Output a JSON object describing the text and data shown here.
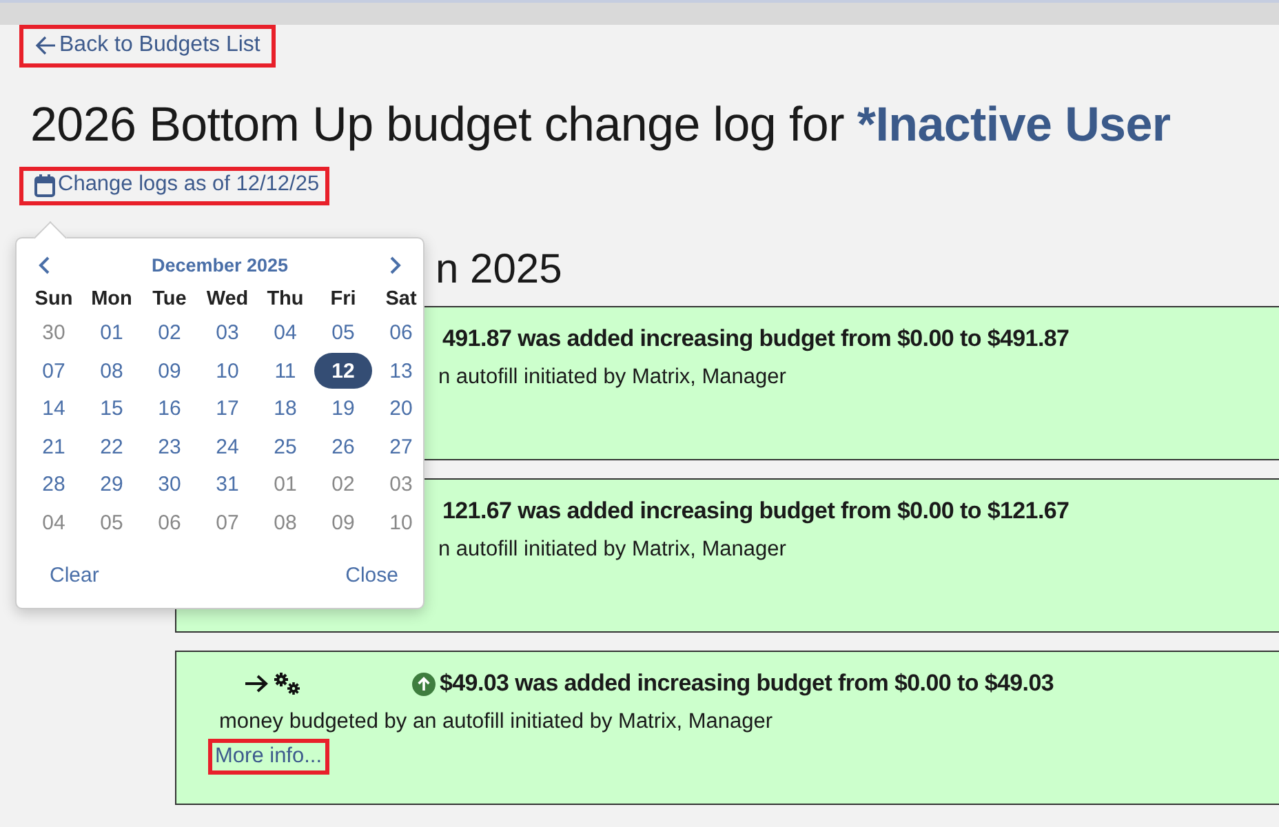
{
  "back_link": {
    "label": "Back to Budgets List",
    "highlighted": true
  },
  "title": {
    "prefix": "2026 Bottom Up budget change log for ",
    "user": "*Inactive User"
  },
  "date_link": {
    "label": "Change logs as of 12/12/25",
    "highlighted": true
  },
  "section_heading": "n 2025",
  "entries": [
    {
      "kind": "partial",
      "summary": "491.87 was added increasing budget from $0.00 to $491.87",
      "detail": "n autofill initiated by Matrix, Manager"
    },
    {
      "kind": "partial",
      "summary": "121.67 was added increasing budget from $0.00 to $121.67",
      "detail": "n autofill initiated by Matrix, Manager"
    },
    {
      "kind": "full",
      "summary": "$49.03 was added increasing budget from $0.00 to $49.03",
      "detail": "money budgeted by an autofill initiated by Matrix, Manager",
      "more": {
        "label": "More info...",
        "highlighted": true
      }
    }
  ],
  "calendar": {
    "month": "December 2025",
    "weekdays": [
      "Sun",
      "Mon",
      "Tue",
      "Wed",
      "Thu",
      "Fri",
      "Sat"
    ],
    "weeks": [
      [
        {
          "label": "30",
          "outside": true,
          "selected": false
        },
        {
          "label": "01",
          "outside": false,
          "selected": false
        },
        {
          "label": "02",
          "outside": false,
          "selected": false
        },
        {
          "label": "03",
          "outside": false,
          "selected": false
        },
        {
          "label": "04",
          "outside": false,
          "selected": false
        },
        {
          "label": "05",
          "outside": false,
          "selected": false
        },
        {
          "label": "06",
          "outside": false,
          "selected": false
        }
      ],
      [
        {
          "label": "07",
          "outside": false,
          "selected": false
        },
        {
          "label": "08",
          "outside": false,
          "selected": false
        },
        {
          "label": "09",
          "outside": false,
          "selected": false
        },
        {
          "label": "10",
          "outside": false,
          "selected": false
        },
        {
          "label": "11",
          "outside": false,
          "selected": false
        },
        {
          "label": "12",
          "outside": false,
          "selected": true
        },
        {
          "label": "13",
          "outside": false,
          "selected": false
        }
      ],
      [
        {
          "label": "14",
          "outside": false,
          "selected": false
        },
        {
          "label": "15",
          "outside": false,
          "selected": false
        },
        {
          "label": "16",
          "outside": false,
          "selected": false
        },
        {
          "label": "17",
          "outside": false,
          "selected": false
        },
        {
          "label": "18",
          "outside": false,
          "selected": false
        },
        {
          "label": "19",
          "outside": false,
          "selected": false
        },
        {
          "label": "20",
          "outside": false,
          "selected": false
        }
      ],
      [
        {
          "label": "21",
          "outside": false,
          "selected": false
        },
        {
          "label": "22",
          "outside": false,
          "selected": false
        },
        {
          "label": "23",
          "outside": false,
          "selected": false
        },
        {
          "label": "24",
          "outside": false,
          "selected": false
        },
        {
          "label": "25",
          "outside": false,
          "selected": false
        },
        {
          "label": "26",
          "outside": false,
          "selected": false
        },
        {
          "label": "27",
          "outside": false,
          "selected": false
        }
      ],
      [
        {
          "label": "28",
          "outside": false,
          "selected": false
        },
        {
          "label": "29",
          "outside": false,
          "selected": false
        },
        {
          "label": "30",
          "outside": false,
          "selected": false
        },
        {
          "label": "31",
          "outside": false,
          "selected": false
        },
        {
          "label": "01",
          "outside": true,
          "selected": false
        },
        {
          "label": "02",
          "outside": true,
          "selected": false
        },
        {
          "label": "03",
          "outside": true,
          "selected": false
        }
      ],
      [
        {
          "label": "04",
          "outside": true,
          "selected": false
        },
        {
          "label": "05",
          "outside": true,
          "selected": false
        },
        {
          "label": "06",
          "outside": true,
          "selected": false
        },
        {
          "label": "07",
          "outside": true,
          "selected": false
        },
        {
          "label": "08",
          "outside": true,
          "selected": false
        },
        {
          "label": "09",
          "outside": true,
          "selected": false
        },
        {
          "label": "10",
          "outside": true,
          "selected": false
        }
      ]
    ],
    "buttons": [
      "Clear",
      "Close"
    ]
  }
}
